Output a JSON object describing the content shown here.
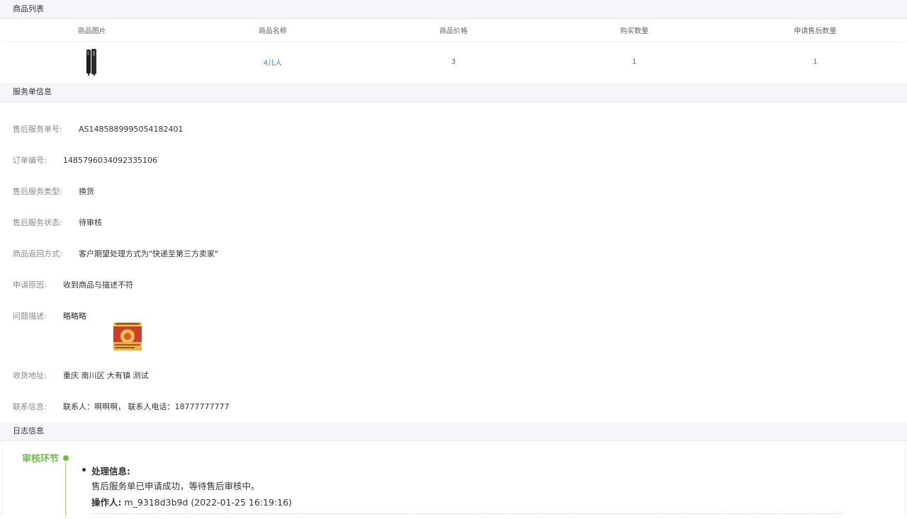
{
  "goods_section": {
    "title": "商品列表",
    "columns": [
      "商品图片",
      "商品名称",
      "商品价格",
      "购买数量",
      "申请售后数量"
    ],
    "rows": [
      {
        "image": "phone-product-image",
        "name": "4儿人",
        "price": "3",
        "quantity": "1",
        "after_sale_quantity": "1"
      }
    ]
  },
  "service_section": {
    "title": "服务单信息",
    "fields": [
      {
        "label": "售后服务单号:",
        "value": "AS1485889995054182401"
      },
      {
        "label": "订单编号:",
        "value": "1485796034092335106"
      },
      {
        "label": "售后服务类型:",
        "value": "换货"
      },
      {
        "label": "售后服务状态:",
        "value": "待审核"
      },
      {
        "label": "商品返回方式:",
        "value": "客户期望处理方式为\"快递至第三方卖家\""
      },
      {
        "label": "申请原因:",
        "value": "收到商品与描述不符"
      },
      {
        "label": "问题描述:",
        "value": "略略略"
      },
      {
        "label": "收货地址:",
        "value": "重庆 南川区 大有镇 测试"
      },
      {
        "label": "联系信息:",
        "value": "联系人：啊啊啊， 联系人电话：18777777777"
      }
    ]
  },
  "log_section": {
    "title": "日志信息",
    "stage": "审核环节",
    "entry": {
      "heading": "处理信息:",
      "message": "售后服务单已申请成功，等待售后审核中。",
      "operator_label": "操作人:",
      "operator_value": "m_9318d3b9d (2022-01-25 16:19:16)"
    }
  },
  "colors": {
    "accent_green": "#6bbd45",
    "link_blue": "#3b74c4",
    "header_bg": "#f4f6f9"
  }
}
